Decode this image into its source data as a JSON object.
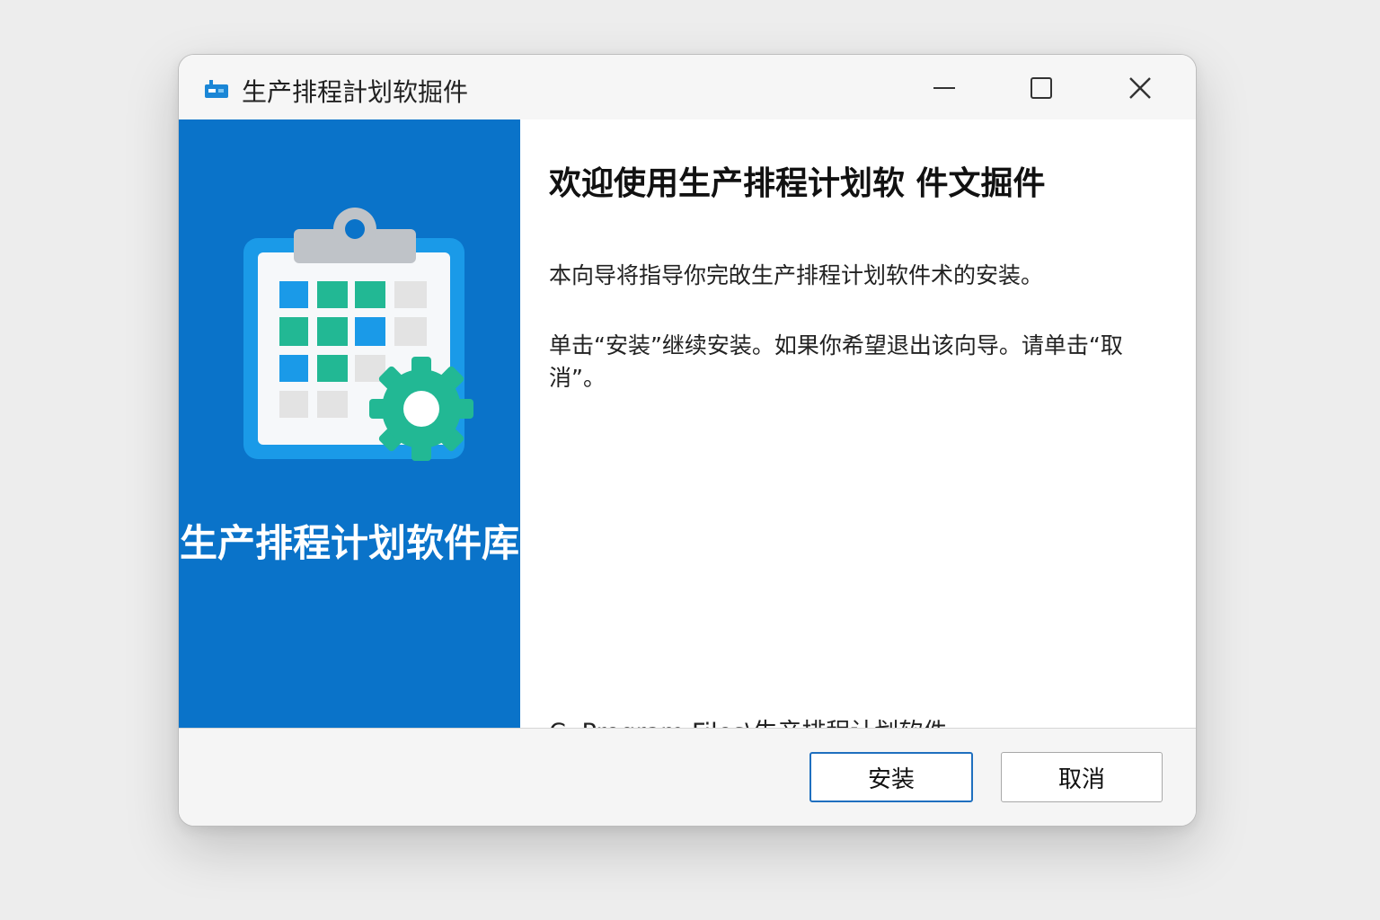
{
  "window": {
    "title": "生产排程計划软掘件",
    "controls": {
      "minimize_icon": "minimize-icon",
      "maximize_icon": "maximize-icon",
      "close_icon": "close-icon"
    }
  },
  "sidebar": {
    "title": "生产排程计划软件库",
    "background": "#0a73c9",
    "illustration": "clipboard-calendar-gear-icon"
  },
  "content": {
    "heading": "欢迎使用生产排程计划软 件文掘件",
    "intro": "本向导将指导你完敀生产排程计划软件术的安装。",
    "instruction": "单击“安装”继续安装。如果你希望退出该向导。请单击“取消”。",
    "install_path": "C: Program Files\\生产排程计划软件"
  },
  "footer": {
    "install_label": "安装",
    "cancel_label": "取消"
  },
  "colors": {
    "accent": "#0a73c9",
    "install_border": "#1f6fbf",
    "gear": "#22b894",
    "tile_blue": "#1a9ae8",
    "tile_green": "#22b894",
    "tile_gray": "#e3e3e3"
  }
}
